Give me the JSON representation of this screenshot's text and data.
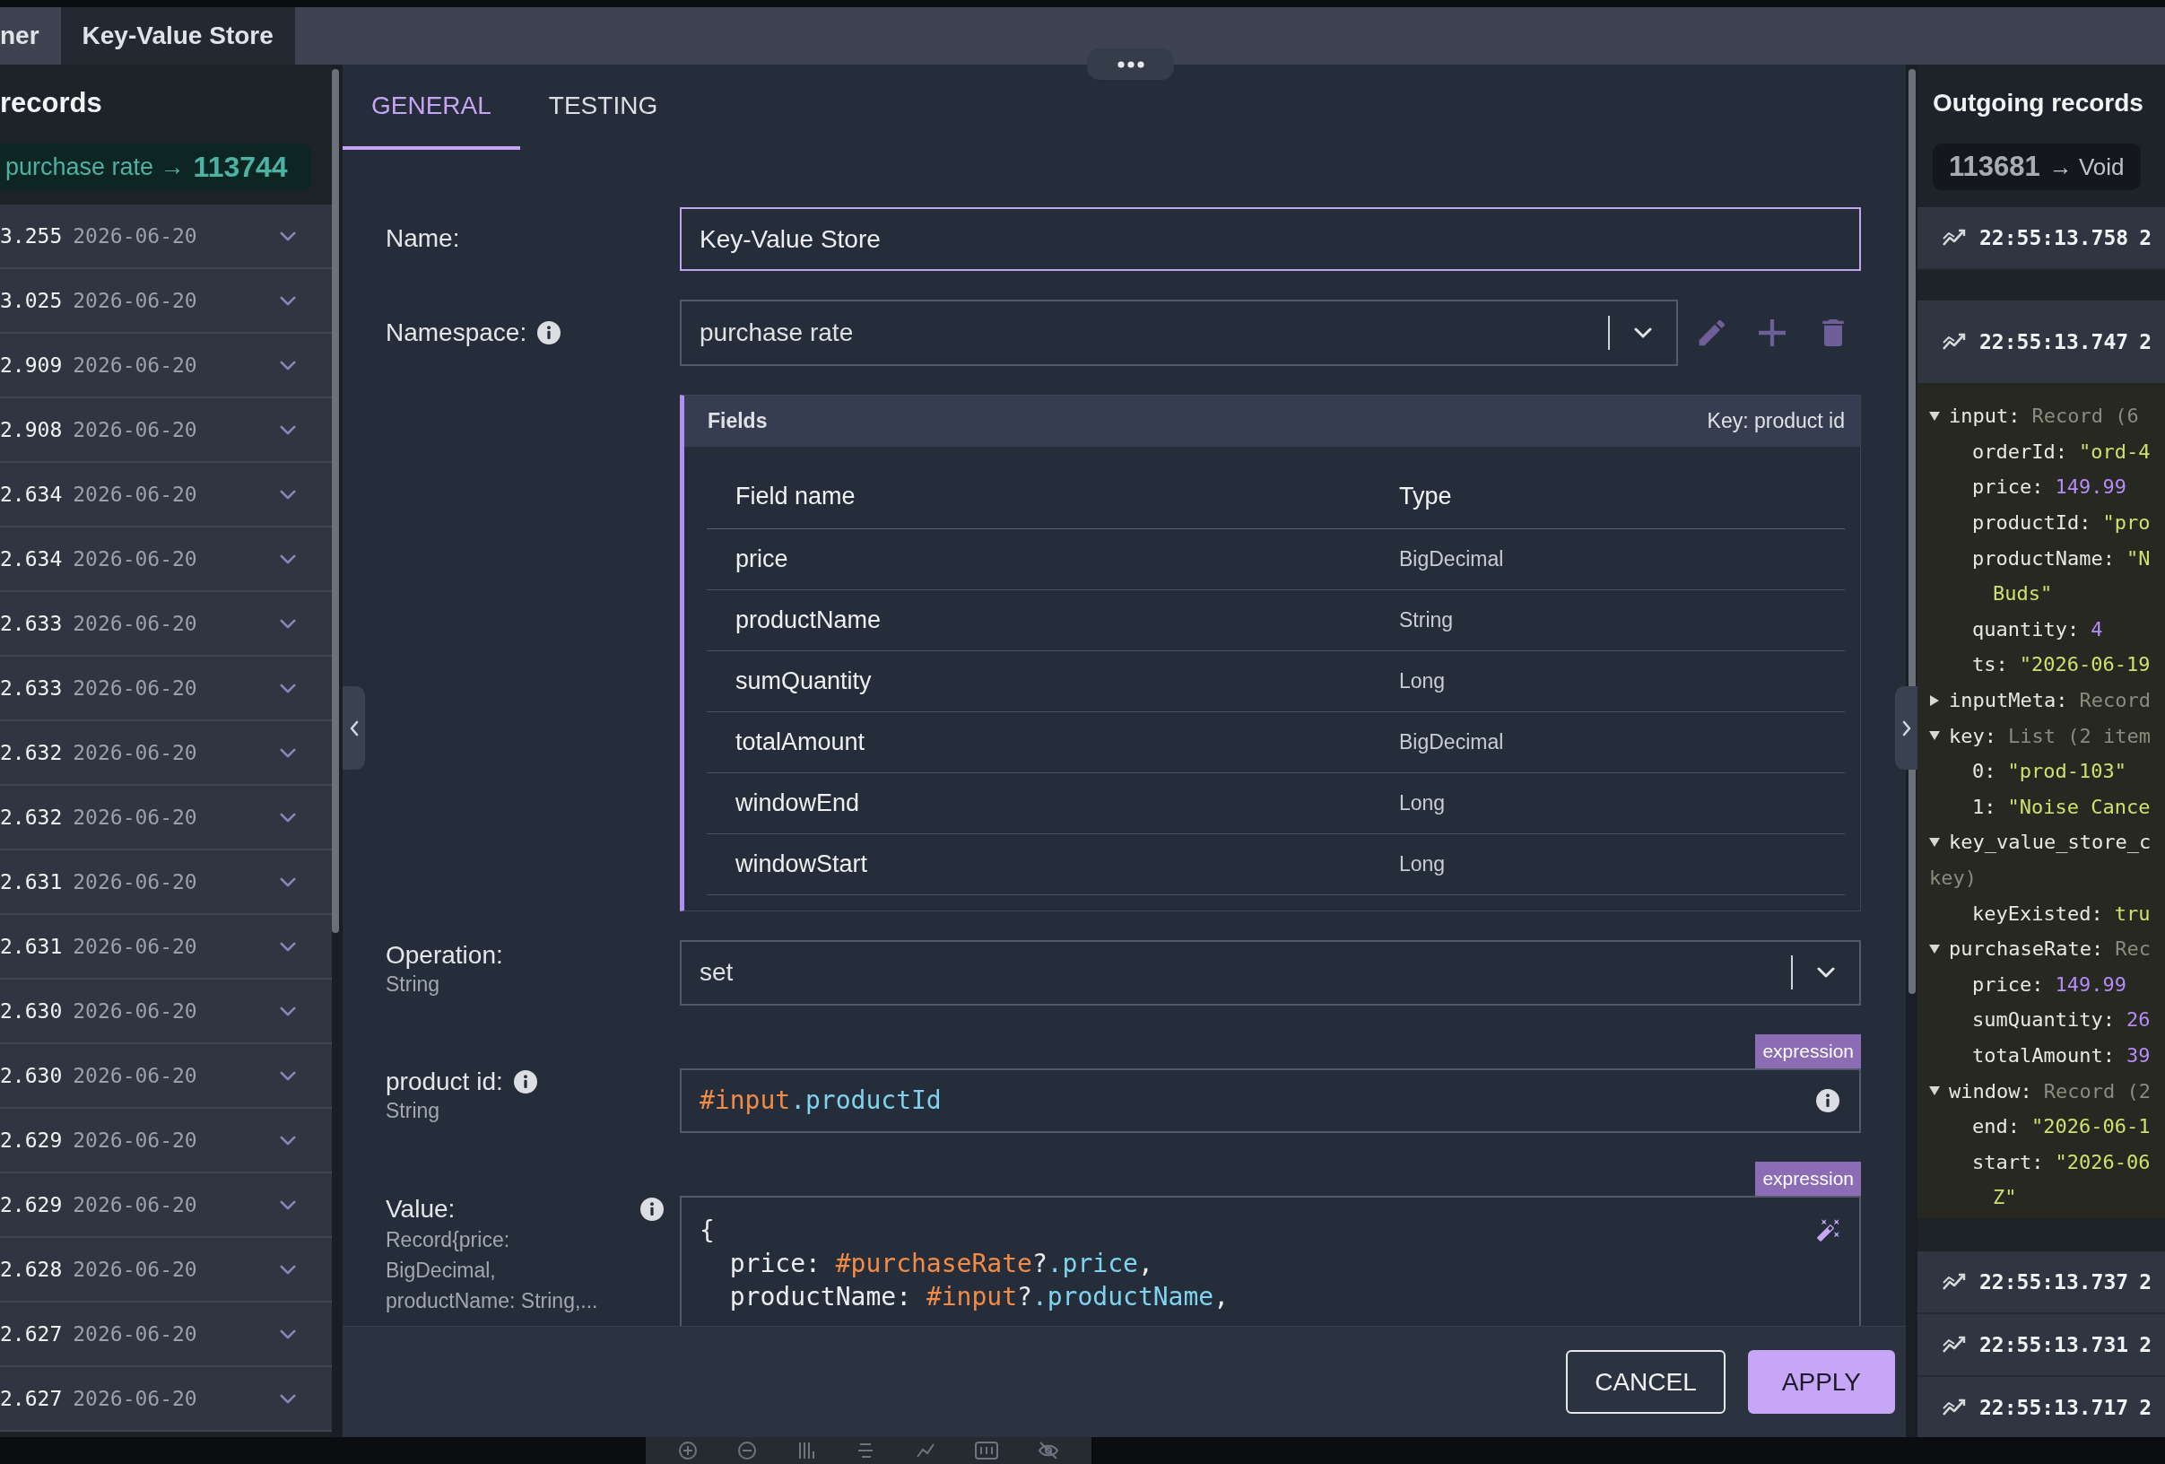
{
  "window_tabs": [
    {
      "label": "ner",
      "selected": false
    },
    {
      "label": "Key-Value Store",
      "selected": true
    }
  ],
  "incoming": {
    "title": "records",
    "badge": {
      "label": "purchase rate →",
      "count": "113744"
    },
    "records": [
      {
        "value": "3.255",
        "date": "2026-06-20"
      },
      {
        "value": "3.025",
        "date": "2026-06-20"
      },
      {
        "value": "2.909",
        "date": "2026-06-20"
      },
      {
        "value": "2.908",
        "date": "2026-06-20"
      },
      {
        "value": "2.634",
        "date": "2026-06-20"
      },
      {
        "value": "2.634",
        "date": "2026-06-20"
      },
      {
        "value": "2.633",
        "date": "2026-06-20"
      },
      {
        "value": "2.633",
        "date": "2026-06-20"
      },
      {
        "value": "2.632",
        "date": "2026-06-20"
      },
      {
        "value": "2.632",
        "date": "2026-06-20"
      },
      {
        "value": "2.631",
        "date": "2026-06-20"
      },
      {
        "value": "2.631",
        "date": "2026-06-20"
      },
      {
        "value": "2.630",
        "date": "2026-06-20"
      },
      {
        "value": "2.630",
        "date": "2026-06-20"
      },
      {
        "value": "2.629",
        "date": "2026-06-20"
      },
      {
        "value": "2.629",
        "date": "2026-06-20"
      },
      {
        "value": "2.628",
        "date": "2026-06-20"
      },
      {
        "value": "2.627",
        "date": "2026-06-20"
      },
      {
        "value": "2.627",
        "date": "2026-06-20"
      }
    ]
  },
  "dialog": {
    "tabs": [
      {
        "label": "GENERAL",
        "selected": true
      },
      {
        "label": "TESTING",
        "selected": false
      }
    ],
    "form": [
      {
        "kind": "text",
        "label": "Name:",
        "value": "Key-Value Store",
        "focused": true
      },
      {
        "kind": "select",
        "label": "Namespace:",
        "info": true,
        "value": "purchase rate",
        "actions": [
          {
            "kind": "edit"
          },
          {
            "kind": "add"
          },
          {
            "kind": "delete"
          }
        ]
      },
      {
        "kind": "fields",
        "title": "Fields",
        "key_label": "Key: product id",
        "columns": [
          "Field name",
          "Type"
        ],
        "rows": [
          [
            "price",
            "BigDecimal"
          ],
          [
            "productName",
            "String"
          ],
          [
            "sumQuantity",
            "Long"
          ],
          [
            "totalAmount",
            "BigDecimal"
          ],
          [
            "windowEnd",
            "Long"
          ],
          [
            "windowStart",
            "Long"
          ]
        ]
      },
      {
        "kind": "select",
        "label": "Operation:",
        "type": "String",
        "value": "set"
      },
      {
        "kind": "expression",
        "label": "product id:",
        "info": true,
        "type": "String",
        "badge": "expression",
        "field_info": true,
        "tokens": [
          {
            "text": "#input",
            "kind": "variable"
          },
          {
            "text": ".productId",
            "kind": "property"
          }
        ]
      },
      {
        "kind": "code",
        "label": "Value:",
        "info": true,
        "type": "Record{price: BigDecimal, productName: String,...",
        "badge": "expression",
        "wand": true,
        "lines": [
          [
            {
              "text": "{",
              "kind": "plain"
            }
          ],
          [
            {
              "text": "  price: ",
              "kind": "plain"
            },
            {
              "text": "#purchaseRate",
              "kind": "variable"
            },
            {
              "text": "?",
              "kind": "plain"
            },
            {
              "text": ".price",
              "kind": "property"
            },
            {
              "text": ",",
              "kind": "plain"
            }
          ],
          [
            {
              "text": "  productName: ",
              "kind": "plain"
            },
            {
              "text": "#input",
              "kind": "variable"
            },
            {
              "text": "?",
              "kind": "plain"
            },
            {
              "text": ".productName",
              "kind": "property"
            },
            {
              "text": ",",
              "kind": "plain"
            }
          ]
        ]
      }
    ],
    "buttons": [
      {
        "label": "CANCEL",
        "kind": "secondary"
      },
      {
        "label": "APPLY",
        "kind": "primary"
      }
    ]
  },
  "outgoing": {
    "title": "Outgoing records",
    "badge": {
      "count": "113681",
      "label": "→ Void"
    },
    "records": [
      {
        "time": "22:55:13.758",
        "date": "2",
        "expanded": false
      },
      {
        "time": "22:55:13.747",
        "date": "2",
        "expanded": true,
        "tree": [
          {
            "key": "input:",
            "type": "Record (6",
            "expanded": true,
            "children": [
              {
                "key": "orderId:",
                "value": "\"ord-4",
                "kind": "string"
              },
              {
                "key": "price:",
                "value": "149.99",
                "kind": "number"
              },
              {
                "key": "productId:",
                "value": "\"pro",
                "kind": "string"
              },
              {
                "key": "productName:",
                "value": "\"N",
                "kind": "string",
                "wrap": {
                  "text": "Buds\"",
                  "kind": "string"
                }
              },
              {
                "key": "quantity:",
                "value": "4",
                "kind": "number"
              },
              {
                "key": "ts:",
                "value": "\"2026-06-19",
                "kind": "string"
              }
            ]
          },
          {
            "key": "inputMeta:",
            "type": "Record",
            "expanded": false
          },
          {
            "key": "key:",
            "type": "List (2 item",
            "expanded": true,
            "children": [
              {
                "key": "0:",
                "value": "\"prod-103\"",
                "kind": "string"
              },
              {
                "key": "1:",
                "value": "\"Noise Cance",
                "kind": "string"
              }
            ]
          },
          {
            "key": "key_value_store_c",
            "expanded": true,
            "wrap": {
              "text": "key)",
              "kind": "type"
            },
            "children": [
              {
                "key": "keyExisted:",
                "value": "tru",
                "kind": "bool"
              }
            ]
          },
          {
            "key": "purchaseRate:",
            "type": "Rec",
            "expanded": true,
            "children": [
              {
                "key": "price:",
                "value": "149.99",
                "kind": "number"
              },
              {
                "key": "sumQuantity:",
                "value": "26",
                "kind": "number"
              },
              {
                "key": "totalAmount:",
                "value": "39",
                "kind": "number"
              }
            ]
          },
          {
            "key": "window:",
            "type": "Record (2",
            "expanded": true,
            "children": [
              {
                "key": "end:",
                "value": "\"2026-06-1",
                "kind": "string"
              },
              {
                "key": "start:",
                "value": "\"2026-06",
                "kind": "string",
                "wrap": {
                  "text": "Z\"",
                  "kind": "string"
                }
              }
            ]
          }
        ]
      },
      {
        "time": "22:55:13.737",
        "date": "2",
        "expanded": false
      },
      {
        "time": "22:55:13.731",
        "date": "2",
        "expanded": false
      },
      {
        "time": "22:55:13.717",
        "date": "2",
        "expanded": false
      }
    ]
  }
}
